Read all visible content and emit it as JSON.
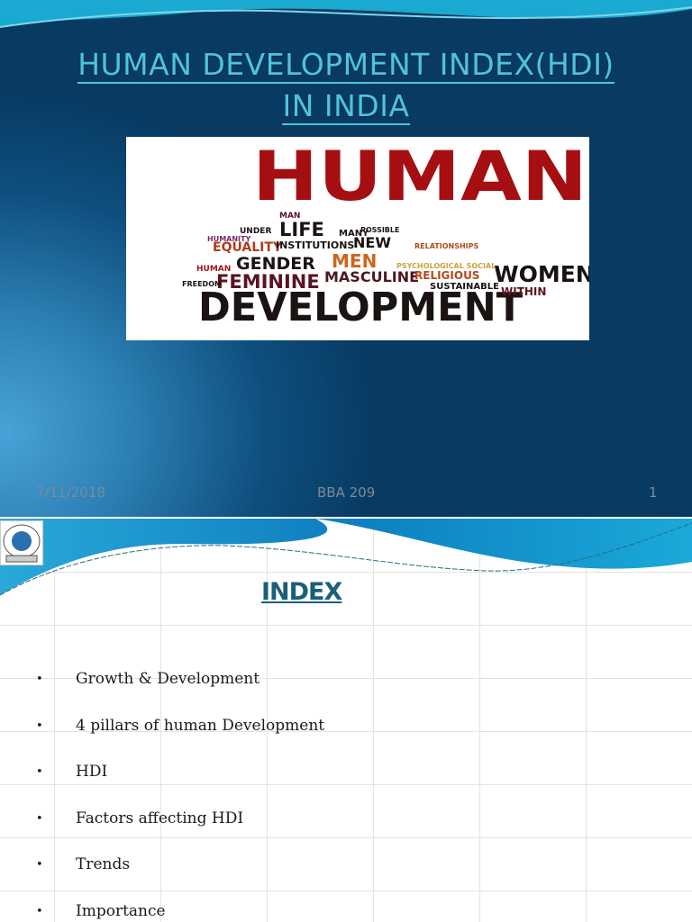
{
  "slide1": {
    "title_line1": "HUMAN DEVELOPMENT INDEX(HDI)",
    "title_line2": "IN  INDIA",
    "image_words": [
      "HUMAN",
      "DEVELOPMENT",
      "WOMEN",
      "FEMININE",
      "GENDER",
      "MASCULINE",
      "MEN",
      "LIFE",
      "EQUALITY",
      "INSTITUTIONS",
      "NEW",
      "MANY",
      "RELIGIOUS",
      "SUSTAINABLE",
      "WITHIN",
      "HUMANITY",
      "PSYCHOLOGICAL SOCIAL",
      "RELATIONSHIPS",
      "HUMAN",
      "FREEDOM",
      "MAN",
      "POSSIBLE",
      "UNDER"
    ],
    "footer_date": "7/11/2018",
    "footer_center": "BBA 209",
    "footer_page": "1"
  },
  "slide2": {
    "title": "INDEX",
    "items": [
      "Growth & Development",
      "4 pillars of human Development",
      "HDI",
      "Factors affecting HDI",
      "Trends",
      "Importance"
    ],
    "bullet": "•"
  },
  "colors": {
    "title": "#4fc3dc",
    "index": "#1b5f7a",
    "bg_dark": "#083a62"
  }
}
